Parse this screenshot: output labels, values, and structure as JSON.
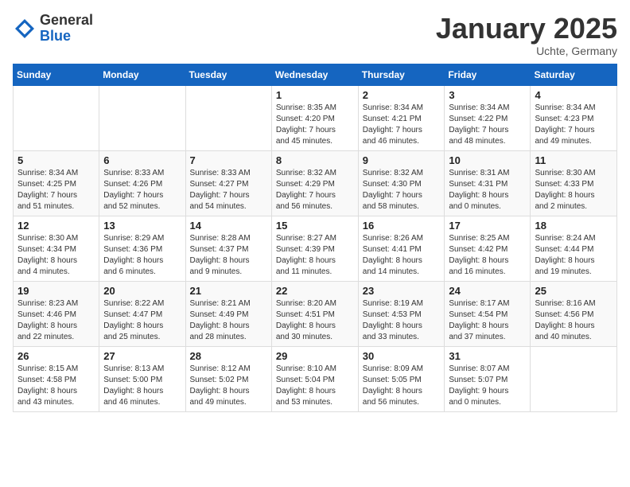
{
  "header": {
    "logo_general": "General",
    "logo_blue": "Blue",
    "month_title": "January 2025",
    "location": "Uchte, Germany"
  },
  "days_of_week": [
    "Sunday",
    "Monday",
    "Tuesday",
    "Wednesday",
    "Thursday",
    "Friday",
    "Saturday"
  ],
  "weeks": [
    [
      {
        "day": "",
        "info": ""
      },
      {
        "day": "",
        "info": ""
      },
      {
        "day": "",
        "info": ""
      },
      {
        "day": "1",
        "info": "Sunrise: 8:35 AM\nSunset: 4:20 PM\nDaylight: 7 hours\nand 45 minutes."
      },
      {
        "day": "2",
        "info": "Sunrise: 8:34 AM\nSunset: 4:21 PM\nDaylight: 7 hours\nand 46 minutes."
      },
      {
        "day": "3",
        "info": "Sunrise: 8:34 AM\nSunset: 4:22 PM\nDaylight: 7 hours\nand 48 minutes."
      },
      {
        "day": "4",
        "info": "Sunrise: 8:34 AM\nSunset: 4:23 PM\nDaylight: 7 hours\nand 49 minutes."
      }
    ],
    [
      {
        "day": "5",
        "info": "Sunrise: 8:34 AM\nSunset: 4:25 PM\nDaylight: 7 hours\nand 51 minutes."
      },
      {
        "day": "6",
        "info": "Sunrise: 8:33 AM\nSunset: 4:26 PM\nDaylight: 7 hours\nand 52 minutes."
      },
      {
        "day": "7",
        "info": "Sunrise: 8:33 AM\nSunset: 4:27 PM\nDaylight: 7 hours\nand 54 minutes."
      },
      {
        "day": "8",
        "info": "Sunrise: 8:32 AM\nSunset: 4:29 PM\nDaylight: 7 hours\nand 56 minutes."
      },
      {
        "day": "9",
        "info": "Sunrise: 8:32 AM\nSunset: 4:30 PM\nDaylight: 7 hours\nand 58 minutes."
      },
      {
        "day": "10",
        "info": "Sunrise: 8:31 AM\nSunset: 4:31 PM\nDaylight: 8 hours\nand 0 minutes."
      },
      {
        "day": "11",
        "info": "Sunrise: 8:30 AM\nSunset: 4:33 PM\nDaylight: 8 hours\nand 2 minutes."
      }
    ],
    [
      {
        "day": "12",
        "info": "Sunrise: 8:30 AM\nSunset: 4:34 PM\nDaylight: 8 hours\nand 4 minutes."
      },
      {
        "day": "13",
        "info": "Sunrise: 8:29 AM\nSunset: 4:36 PM\nDaylight: 8 hours\nand 6 minutes."
      },
      {
        "day": "14",
        "info": "Sunrise: 8:28 AM\nSunset: 4:37 PM\nDaylight: 8 hours\nand 9 minutes."
      },
      {
        "day": "15",
        "info": "Sunrise: 8:27 AM\nSunset: 4:39 PM\nDaylight: 8 hours\nand 11 minutes."
      },
      {
        "day": "16",
        "info": "Sunrise: 8:26 AM\nSunset: 4:41 PM\nDaylight: 8 hours\nand 14 minutes."
      },
      {
        "day": "17",
        "info": "Sunrise: 8:25 AM\nSunset: 4:42 PM\nDaylight: 8 hours\nand 16 minutes."
      },
      {
        "day": "18",
        "info": "Sunrise: 8:24 AM\nSunset: 4:44 PM\nDaylight: 8 hours\nand 19 minutes."
      }
    ],
    [
      {
        "day": "19",
        "info": "Sunrise: 8:23 AM\nSunset: 4:46 PM\nDaylight: 8 hours\nand 22 minutes."
      },
      {
        "day": "20",
        "info": "Sunrise: 8:22 AM\nSunset: 4:47 PM\nDaylight: 8 hours\nand 25 minutes."
      },
      {
        "day": "21",
        "info": "Sunrise: 8:21 AM\nSunset: 4:49 PM\nDaylight: 8 hours\nand 28 minutes."
      },
      {
        "day": "22",
        "info": "Sunrise: 8:20 AM\nSunset: 4:51 PM\nDaylight: 8 hours\nand 30 minutes."
      },
      {
        "day": "23",
        "info": "Sunrise: 8:19 AM\nSunset: 4:53 PM\nDaylight: 8 hours\nand 33 minutes."
      },
      {
        "day": "24",
        "info": "Sunrise: 8:17 AM\nSunset: 4:54 PM\nDaylight: 8 hours\nand 37 minutes."
      },
      {
        "day": "25",
        "info": "Sunrise: 8:16 AM\nSunset: 4:56 PM\nDaylight: 8 hours\nand 40 minutes."
      }
    ],
    [
      {
        "day": "26",
        "info": "Sunrise: 8:15 AM\nSunset: 4:58 PM\nDaylight: 8 hours\nand 43 minutes."
      },
      {
        "day": "27",
        "info": "Sunrise: 8:13 AM\nSunset: 5:00 PM\nDaylight: 8 hours\nand 46 minutes."
      },
      {
        "day": "28",
        "info": "Sunrise: 8:12 AM\nSunset: 5:02 PM\nDaylight: 8 hours\nand 49 minutes."
      },
      {
        "day": "29",
        "info": "Sunrise: 8:10 AM\nSunset: 5:04 PM\nDaylight: 8 hours\nand 53 minutes."
      },
      {
        "day": "30",
        "info": "Sunrise: 8:09 AM\nSunset: 5:05 PM\nDaylight: 8 hours\nand 56 minutes."
      },
      {
        "day": "31",
        "info": "Sunrise: 8:07 AM\nSunset: 5:07 PM\nDaylight: 9 hours\nand 0 minutes."
      },
      {
        "day": "",
        "info": ""
      }
    ]
  ]
}
